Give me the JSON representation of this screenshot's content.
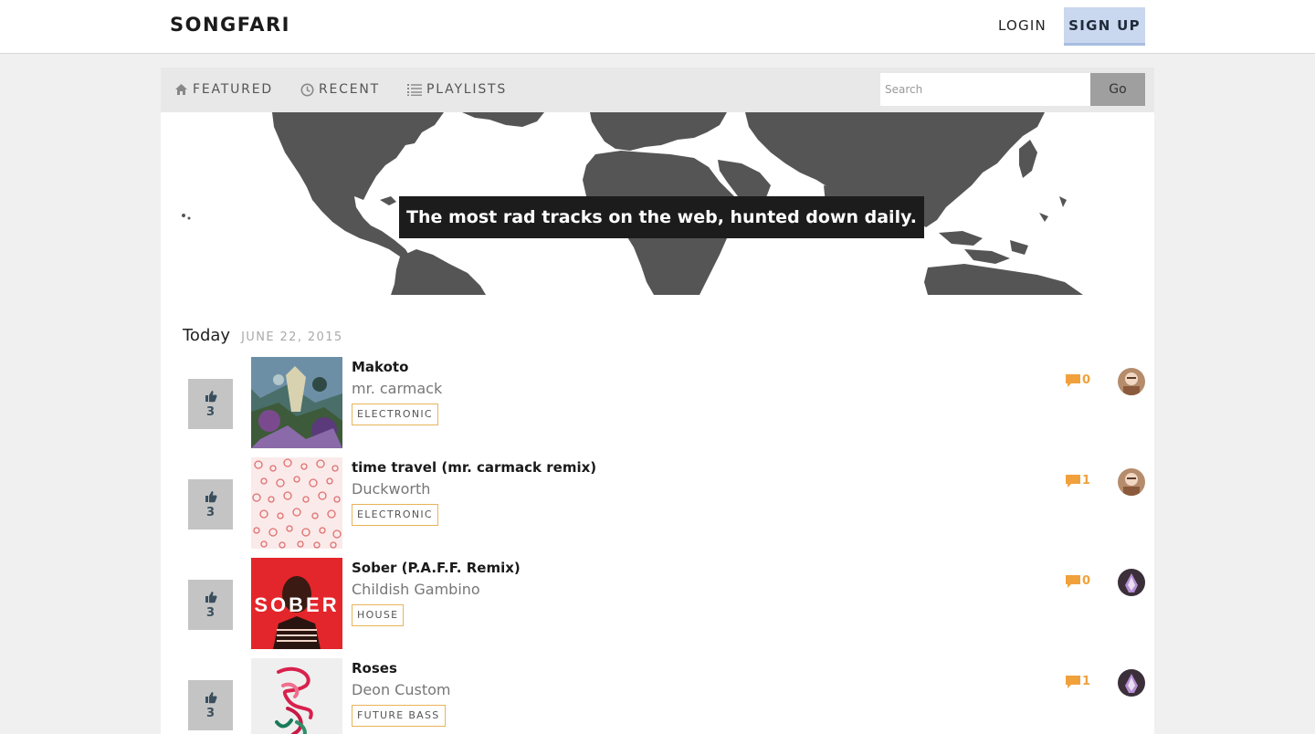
{
  "header": {
    "brand": "SONGFARI",
    "login_label": "LOGIN",
    "signup_label": "SIGN UP"
  },
  "nav": {
    "items": [
      {
        "label": "FEATURED",
        "icon": "home-icon"
      },
      {
        "label": "RECENT",
        "icon": "clock-icon"
      },
      {
        "label": "PLAYLISTS",
        "icon": "list-icon"
      }
    ],
    "search_placeholder": "Search",
    "go_label": "Go"
  },
  "hero": {
    "tagline": "The most rad tracks on the web, hunted down daily."
  },
  "day": {
    "label": "Today",
    "date": "JUNE 22, 2015"
  },
  "colors": {
    "accent": "#f1a13c",
    "signup_bg": "#c9d7ef",
    "vote_bg": "#c4c4c4",
    "map": "#555555"
  },
  "tracks": [
    {
      "title": "Makoto",
      "artist": "mr. carmack",
      "genre": "ELECTRONIC",
      "votes": "3",
      "comments": "0",
      "icon": "thumbs-up-icon"
    },
    {
      "title": "time travel (mr. carmack remix)",
      "artist": "Duckworth",
      "genre": "ELECTRONIC",
      "votes": "3",
      "comments": "1",
      "icon": "thumbs-up-icon"
    },
    {
      "title": "Sober (P.A.F.F. Remix)",
      "artist": "Childish Gambino",
      "genre": "HOUSE",
      "votes": "3",
      "comments": "0",
      "icon": "thumbs-up-icon",
      "art_text": "SOBER"
    },
    {
      "title": "Roses",
      "artist": "Deon Custom",
      "genre": "FUTURE BASS",
      "votes": "3",
      "comments": "1",
      "icon": "thumbs-up-icon"
    }
  ]
}
